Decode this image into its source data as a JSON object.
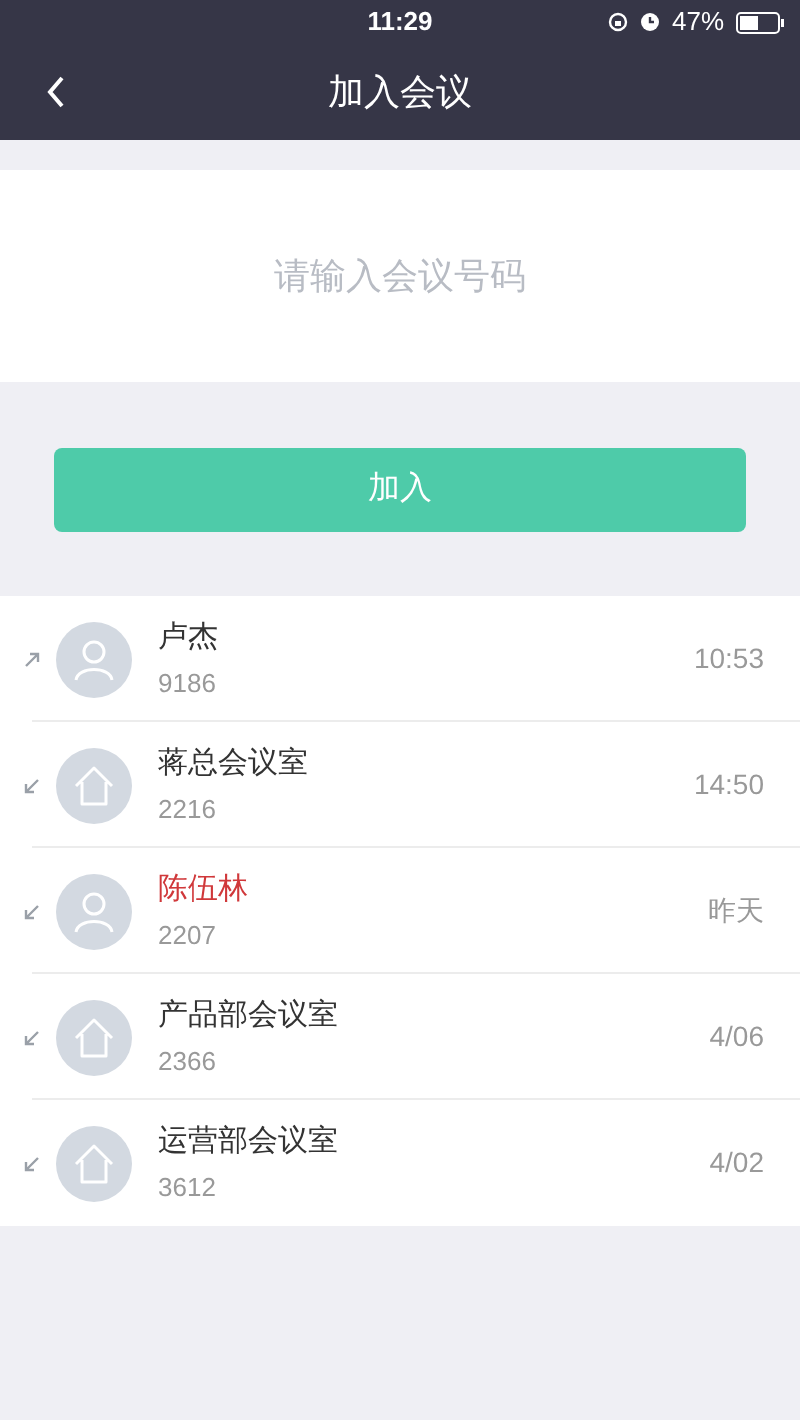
{
  "status_bar": {
    "time": "11:29",
    "battery_text": "47%"
  },
  "nav": {
    "title": "加入会议"
  },
  "meeting_field": {
    "placeholder": "请输入会议号码"
  },
  "join_button": "加入",
  "calls": [
    {
      "arrow": {
        "kind": "outgoing"
      },
      "avatar": {
        "kind": "person"
      },
      "name": "卢杰",
      "number": "9186",
      "time": "10:53",
      "missed": false
    },
    {
      "arrow": {
        "kind": "incoming"
      },
      "avatar": {
        "kind": "room"
      },
      "name": "蒋总会议室",
      "number": "2216",
      "time": "14:50",
      "missed": false
    },
    {
      "arrow": {
        "kind": "incoming"
      },
      "avatar": {
        "kind": "person"
      },
      "name": "陈伍林",
      "number": "2207",
      "time": "昨天",
      "missed": true
    },
    {
      "arrow": {
        "kind": "incoming"
      },
      "avatar": {
        "kind": "room"
      },
      "name": "产品部会议室",
      "number": "2366",
      "time": "4/06",
      "missed": false
    },
    {
      "arrow": {
        "kind": "incoming"
      },
      "avatar": {
        "kind": "room"
      },
      "name": "运营部会议室",
      "number": "3612",
      "time": "4/02",
      "missed": false
    }
  ]
}
